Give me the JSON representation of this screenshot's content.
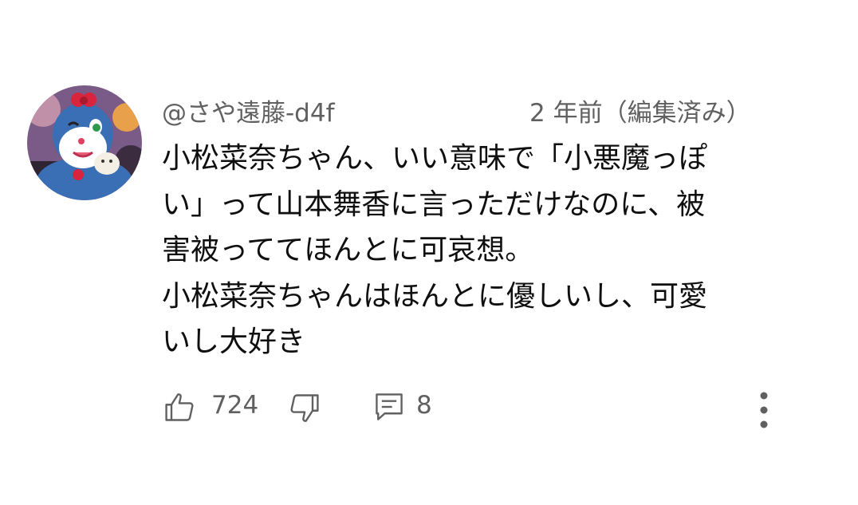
{
  "comment": {
    "author": "@さや遠藤-d4f",
    "timestamp": "2 年前（編集済み）",
    "body_lines": [
      "小松菜奈ちゃん、いい意味で「小悪魔っぽ",
      "い」って山本舞香に言っただけなのに、被",
      "害被っててほんとに可哀想。",
      "小松菜奈ちゃんはほんとに優しいし、可愛",
      "いし大好き"
    ],
    "like_count": "724",
    "reply_count": "8"
  },
  "icons": {
    "like": "thumbs-up-icon",
    "dislike": "thumbs-down-icon",
    "reply": "reply-comment-icon",
    "more": "more-vertical-icon"
  },
  "colors": {
    "secondary_text": "#606060",
    "primary_text": "#0f0f0f",
    "background": "#ffffff"
  }
}
